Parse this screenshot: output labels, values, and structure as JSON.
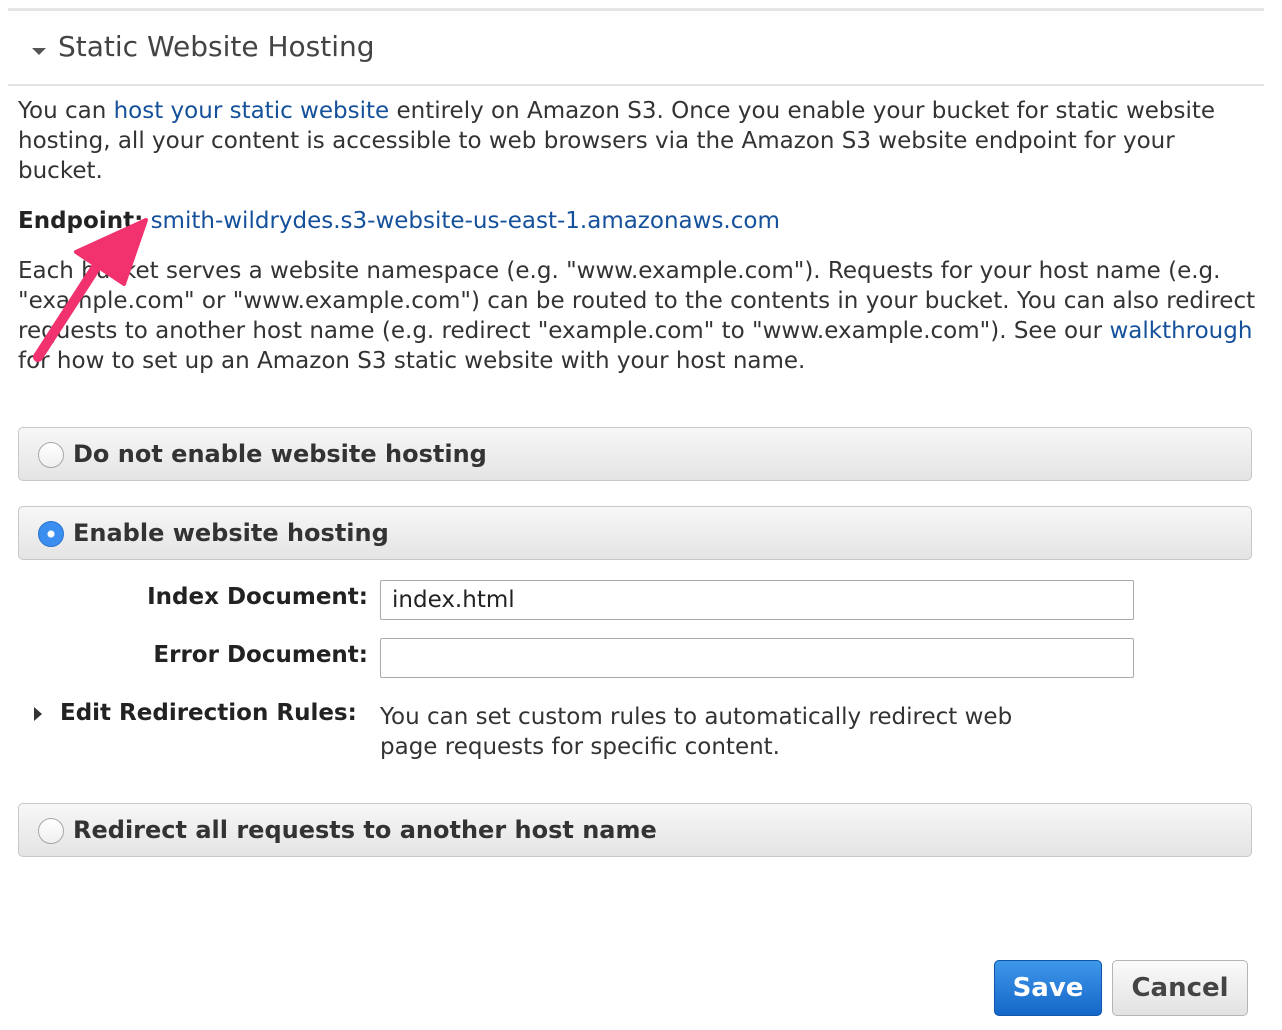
{
  "section": {
    "title": "Static Website Hosting"
  },
  "intro": {
    "before": "You can ",
    "link": "host your static website",
    "after": " entirely on Amazon S3. Once you enable your bucket for static website hosting, all your content is accessible to web browsers via the Amazon S3 website endpoint for your bucket."
  },
  "endpoint": {
    "label": "Endpoint:",
    "value": "smith-wildrydes.s3-website-us-east-1.amazonaws.com"
  },
  "namespace": {
    "before": "Each bucket serves a website namespace (e.g. \"www.example.com\"). Requests for your host name (e.g. \"example.com\" or \"www.example.com\") can be routed to the contents in your bucket. You can also redirect requests to another host name (e.g. redirect \"example.com\" to \"www.example.com\"). See our ",
    "link": "walkthrough",
    "after": " for how to set up an Amazon S3 static website with your host name."
  },
  "options": {
    "disable": {
      "label": "Do not enable website hosting",
      "selected": false
    },
    "enable": {
      "label": "Enable website hosting",
      "selected": true
    },
    "redirect": {
      "label": "Redirect all requests to another host name",
      "selected": false
    }
  },
  "form": {
    "index_label": "Index Document:",
    "index_value": "index.html",
    "error_label": "Error Document:",
    "error_value": "",
    "redirection_label": "Edit Redirection Rules:",
    "redirection_desc": "You can set custom rules to automatically redirect web page requests for specific content."
  },
  "buttons": {
    "save": "Save",
    "cancel": "Cancel"
  },
  "colors": {
    "link": "#15519b",
    "primary": "#1f78d8",
    "annotation_arrow": "#f2326f"
  },
  "icons": {
    "section_toggle": "caret-down-icon",
    "redirection_toggle": "caret-right-icon"
  }
}
